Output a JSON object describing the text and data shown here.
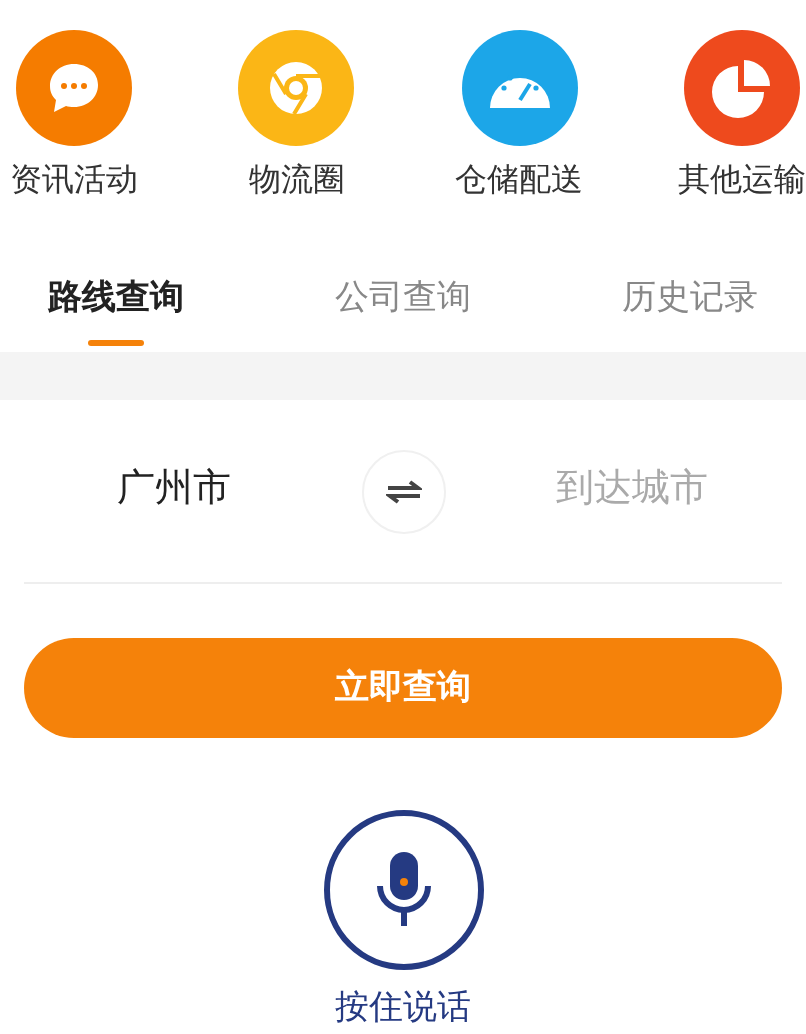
{
  "shortcuts": [
    {
      "label": "资讯活动",
      "kind": "chat",
      "color": "#f57c00"
    },
    {
      "label": "物流圈",
      "kind": "ring",
      "color": "#fbb616"
    },
    {
      "label": "仓储配送",
      "kind": "gauge",
      "color": "#1ca6e8"
    },
    {
      "label": "其他运输",
      "kind": "pie",
      "color": "#ee4a1d"
    }
  ],
  "tabs": [
    {
      "label": "路线查询",
      "selected": true
    },
    {
      "label": "公司查询",
      "selected": false
    },
    {
      "label": "历史记录",
      "selected": false
    }
  ],
  "route": {
    "from": "广州市",
    "to_placeholder": "到达城市"
  },
  "search_button": "立即查询",
  "voice": {
    "label": "按住说话"
  }
}
